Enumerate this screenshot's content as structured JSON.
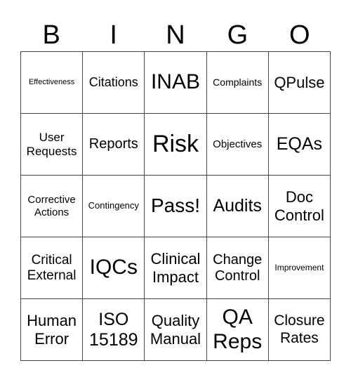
{
  "header": [
    "B",
    "I",
    "N",
    "G",
    "O"
  ],
  "cells": [
    {
      "text": "Effectiveness",
      "size": "s11"
    },
    {
      "text": "Citations",
      "size": "s18"
    },
    {
      "text": "INAB",
      "size": "s30"
    },
    {
      "text": "Complaints",
      "size": "s14"
    },
    {
      "text": "QPulse",
      "size": "s22"
    },
    {
      "text": "User Requests",
      "size": "s17"
    },
    {
      "text": "Reports",
      "size": "s20"
    },
    {
      "text": "Risk",
      "size": "s34"
    },
    {
      "text": "Objectives",
      "size": "s15"
    },
    {
      "text": "EQAs",
      "size": "s25"
    },
    {
      "text": "Corrective Actions",
      "size": "s15"
    },
    {
      "text": "Contingency",
      "size": "s13"
    },
    {
      "text": "Pass!",
      "size": "s28"
    },
    {
      "text": "Audits",
      "size": "s25"
    },
    {
      "text": "Doc Control",
      "size": "s22"
    },
    {
      "text": "Critical External",
      "size": "s19"
    },
    {
      "text": "IQCs",
      "size": "s30"
    },
    {
      "text": "Clinical Impact",
      "size": "s22"
    },
    {
      "text": "Change Control",
      "size": "s20"
    },
    {
      "text": "Improvement",
      "size": "s12"
    },
    {
      "text": "Human Error",
      "size": "s22"
    },
    {
      "text": "ISO 15189",
      "size": "s25"
    },
    {
      "text": "Quality Manual",
      "size": "s22"
    },
    {
      "text": "QA Reps",
      "size": "s30"
    },
    {
      "text": "Closure Rates",
      "size": "s21"
    }
  ]
}
